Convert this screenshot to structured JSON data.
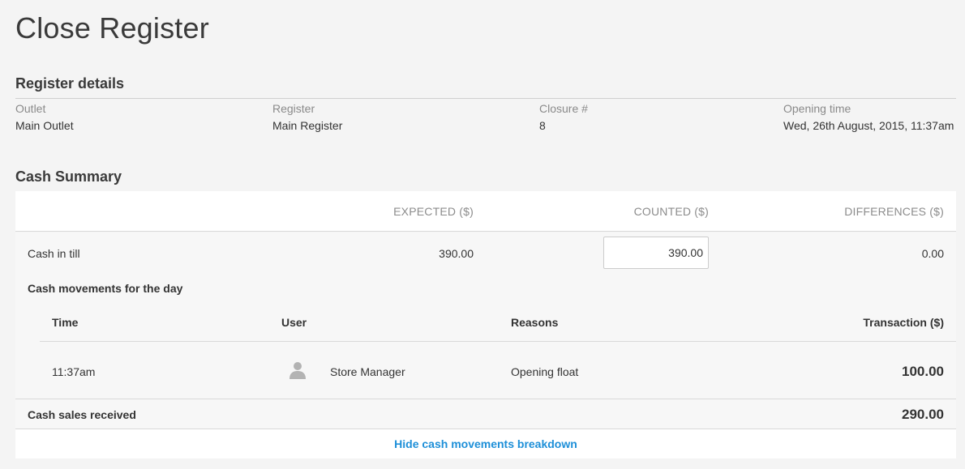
{
  "page": {
    "title": "Close Register"
  },
  "register_details": {
    "heading": "Register details",
    "fields": [
      {
        "label": "Outlet",
        "value": "Main Outlet"
      },
      {
        "label": "Register",
        "value": "Main Register"
      },
      {
        "label": "Closure #",
        "value": "8"
      },
      {
        "label": "Opening time",
        "value": "Wed, 26th August, 2015, 11:37am"
      }
    ]
  },
  "cash_summary": {
    "heading": "Cash Summary",
    "columns": {
      "expected": "EXPECTED ($)",
      "counted": "COUNTED ($)",
      "differences": "DIFFERENCES ($)"
    },
    "cash_in_till": {
      "label": "Cash in till",
      "expected": "390.00",
      "counted": "390.00",
      "difference": "0.00"
    },
    "movements": {
      "heading": "Cash movements for the day",
      "columns": {
        "time": "Time",
        "user": "User",
        "reasons": "Reasons",
        "transaction": "Transaction ($)"
      },
      "rows": [
        {
          "time": "11:37am",
          "user": "Store Manager",
          "reason": "Opening float",
          "amount": "100.00",
          "avatar_icon": "user-avatar-icon"
        }
      ]
    },
    "cash_sales": {
      "label": "Cash sales received",
      "value": "290.00"
    },
    "toggle_link": "Hide cash movements breakdown"
  },
  "colors": {
    "link": "#1d8fd8",
    "background": "#f4f4f4",
    "panel": "#ffffff",
    "muted_text": "#8a8a8a"
  }
}
